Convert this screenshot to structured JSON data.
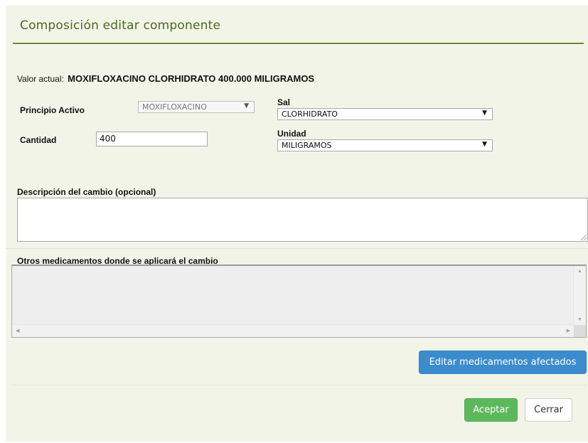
{
  "dialog": {
    "title": "Composición editar componente",
    "current_value": {
      "label": "Valor actual:",
      "value": "MOXIFLOXACINO CLORHIDRATO 400.000 MILIGRAMOS"
    },
    "fields": {
      "principio_activo": {
        "label": "Principio Activo",
        "value": "MOXIFLOXACINO",
        "disabled": true
      },
      "sal": {
        "label": "Sal",
        "value": "CLORHIDRATO"
      },
      "cantidad": {
        "label": "Cantidad",
        "value": "400"
      },
      "unidad": {
        "label": "Unidad",
        "value": "MILIGRAMOS"
      }
    },
    "description": {
      "label": "Descripción del cambio (opcional)",
      "value": ""
    },
    "other_medicines": {
      "label": "Otros medicamentos donde se aplicará el cambio",
      "items": []
    },
    "buttons": {
      "edit_affected": "Editar medicamentos afectados",
      "accept": "Aceptar",
      "close": "Cerrar"
    },
    "icons": {
      "dropdown": "chevron-down-icon",
      "scroll_up": "arrow-up-icon",
      "scroll_down": "arrow-down-icon",
      "scroll_left": "arrow-left-icon",
      "scroll_right": "arrow-right-icon",
      "resize": "resize-grip-icon"
    },
    "colors": {
      "background": "#f2f4e8",
      "title": "#4a6a1c",
      "primary_button": "#3b8ccc",
      "success_button": "#5cb85c"
    }
  }
}
